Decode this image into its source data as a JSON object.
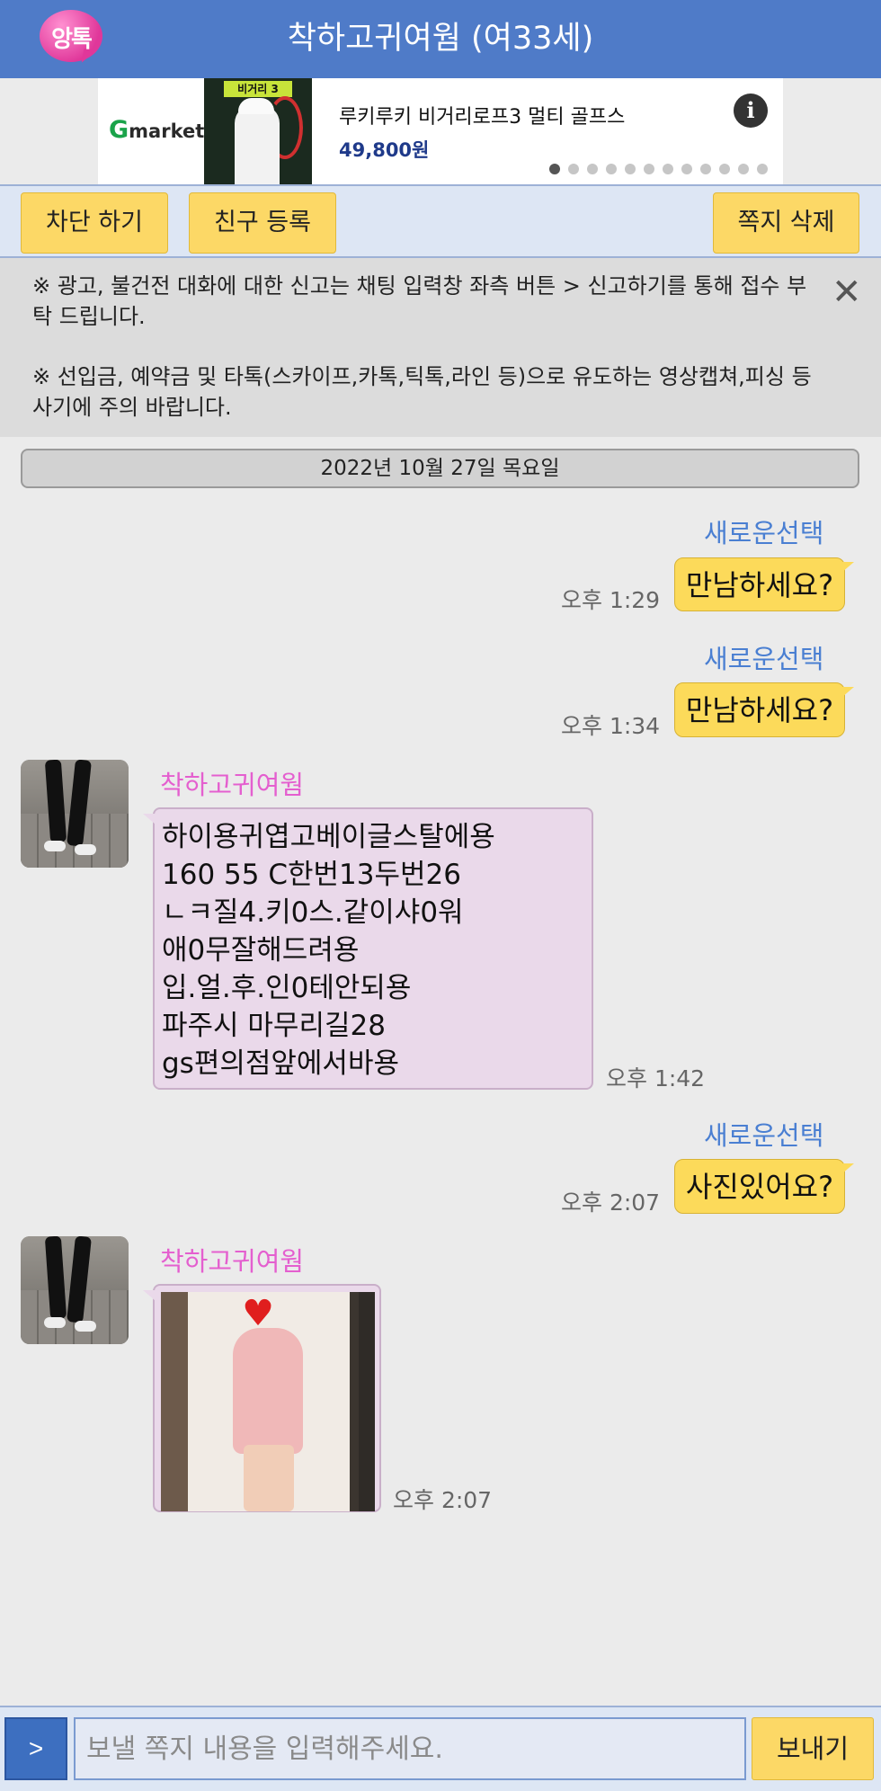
{
  "header": {
    "logo_text": "앙톡",
    "title": "착하고귀여웜 (여33세)"
  },
  "ad": {
    "brand": {
      "g": "G",
      "rest": "market"
    },
    "image_tag": "비거리 3",
    "product": "루키루키 비거리로프3 멀티 골프스",
    "price": "49,800원",
    "info_icon": "info-icon",
    "dots_total": 12,
    "active_dot": 0
  },
  "actions": {
    "block": "차단 하기",
    "add_friend": "친구 등록",
    "delete": "쪽지 삭제"
  },
  "notice": {
    "line1": "※ 광고, 불건전 대화에 대한 신고는 채팅 입력창 좌측 버튼 > 신고하기를 통해 접수 부탁 드립니다.",
    "line2": "※ 선입금, 예약금 및 타톡(스카이프,카톡,틱톡,라인 등)으로 유도하는 영상캡쳐,피싱 등 사기에 주의 바랍니다.",
    "close_icon": "close-icon"
  },
  "date": "2022년 10월 27일 목요일",
  "messages": [
    {
      "sender": "새로운선택",
      "time": "오후 1:29",
      "text": "만남하세요?"
    },
    {
      "sender": "새로운선택",
      "time": "오후 1:34",
      "text": "만남하세요?"
    },
    {
      "sender": "착하고귀여웜",
      "time": "오후 1:42",
      "lines": [
        "하이용귀엽고베이글스탈에용",
        "160 55 C한번13두번26",
        "ㄴㅋ질4.키0스.같이샤0워",
        "애0무잘해드려용",
        "입.얼.후.인0테안되용",
        "파주시 마무리길28",
        "gs편의점앞에서바용"
      ]
    },
    {
      "sender": "새로운선택",
      "time": "오후 2:07",
      "text": "사진있어요?"
    },
    {
      "sender": "착하고귀여웜",
      "time": "오후 2:07"
    }
  ],
  "input": {
    "plus_label": ">",
    "placeholder": "보낼 쪽지 내용을 입력해주세요.",
    "value": "",
    "send": "보내기"
  },
  "colors": {
    "header": "#4f7bc8",
    "yellow": "#fcda5a",
    "pink_bubble": "#ead9ea",
    "sender_me": "#4a7fd2",
    "sender_other": "#e45fcf"
  }
}
